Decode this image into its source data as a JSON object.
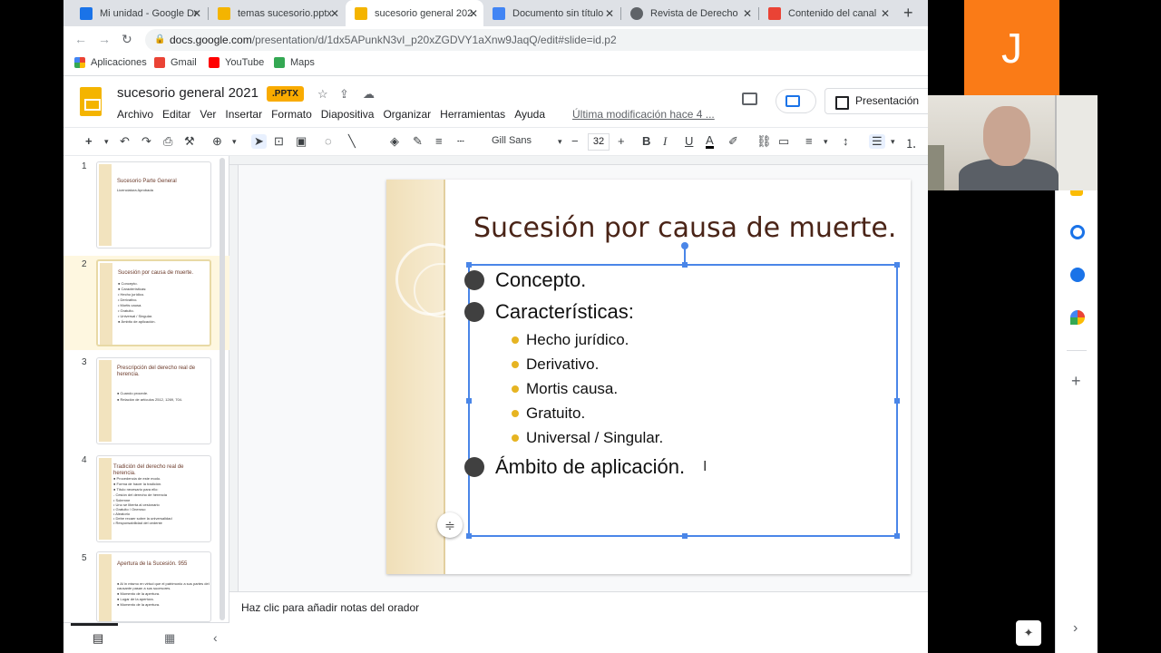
{
  "tabs": [
    {
      "title": "Mi unidad - Google Dr",
      "favicon_color": "#1a73e8"
    },
    {
      "title": "temas sucesorio.pptx",
      "favicon_color": "#f4b400"
    },
    {
      "title": "sucesorio general 202",
      "favicon_color": "#f4b400",
      "active": true
    },
    {
      "title": "Documento sin título",
      "favicon_color": "#4285f4"
    },
    {
      "title": "Revista de Derecho",
      "favicon_color": "#5f6368"
    },
    {
      "title": "Contenido del canal",
      "favicon_color": "#ea4335"
    }
  ],
  "address": {
    "host": "docs.google.com",
    "path": "/presentation/d/1dx5APunkN3vI_p20xZGDVY1aXnw9JaqQ/edit#slide=id.p2"
  },
  "bookmarks": [
    {
      "label": "Aplicaciones",
      "color": "#ea4335"
    },
    {
      "label": "Gmail",
      "color": "#ea4335"
    },
    {
      "label": "YouTube",
      "color": "#ff0000"
    },
    {
      "label": "Maps",
      "color": "#34a853"
    }
  ],
  "document": {
    "title": "sucesorio general 2021",
    "badge": ".PPTX",
    "last_modified": "Última modificación hace 4 ...",
    "present_label": "Presentación"
  },
  "menu": [
    "Archivo",
    "Editar",
    "Ver",
    "Insertar",
    "Formato",
    "Diapositiva",
    "Organizar",
    "Herramientas",
    "Ayuda"
  ],
  "toolbar": {
    "font": "Gill Sans",
    "font_size": "32"
  },
  "thumbnails": [
    {
      "num": "1",
      "title": "Sucesorio Parte General",
      "lines": [
        "Licenciatura Aprobada"
      ]
    },
    {
      "num": "2",
      "title": "Sucesión por causa de muerte.",
      "lines": [
        "● Concepto.",
        "● Características:",
        "   • Hecho jurídico.",
        "   • Derivativo.",
        "   • Mortis causa.",
        "   • Gratuito.",
        "   • Universal / Singular.",
        "● Ámbito de aplicación."
      ]
    },
    {
      "num": "3",
      "title": "Prescripción del derecho real de herencia.",
      "lines": [
        "● Cuando procede.",
        "● Relación de artículos 2512, 1269, 704."
      ]
    },
    {
      "num": "4",
      "title": "Tradición del derecho real de herencia.",
      "lines": [
        "● Procedencia de este modo.",
        "● Forma de hacer la tradición.",
        "● Título necesario para ello:",
        "   - Cesión del derecho de herencia",
        "      • Solemne",
        "      • Uno se liberta al cesionario",
        "      • Gratuito / Oneroso",
        "      • Aleatorio",
        "      • Debe recaer sobre la universalidad",
        "      • Responsabilidad del cedente"
      ]
    },
    {
      "num": "5",
      "title": "Apertura de la Sucesión. 955",
      "lines": [
        "● Al in mismo en virtud que el patrimonio a sus partes del",
        "   causante pasan a sus sucesores.",
        "● Momento de la apertura.",
        "● Lugar de la apertura.",
        "● Momento de la apertura."
      ]
    }
  ],
  "slide": {
    "title": "Sucesión por causa de muerte.",
    "bullets": [
      {
        "text": "Concepto.",
        "level": 1
      },
      {
        "text": "Características:",
        "level": 1
      },
      {
        "text": "Hecho jurídico.",
        "level": 2
      },
      {
        "text": "Derivativo.",
        "level": 2
      },
      {
        "text": "Mortis causa.",
        "level": 2
      },
      {
        "text": "Gratuito.",
        "level": 2
      },
      {
        "text": "Universal / Singular.",
        "level": 2
      },
      {
        "text": "Ámbito de aplicación.",
        "level": 1
      }
    ]
  },
  "notes_placeholder": "Haz clic para añadir notas del orador",
  "avatar_letter": "J",
  "colors": {
    "accent": "#1a73e8",
    "slides_yellow": "#f4b400",
    "title_brown": "#4a2417",
    "avatar_orange": "#fa7b17"
  }
}
